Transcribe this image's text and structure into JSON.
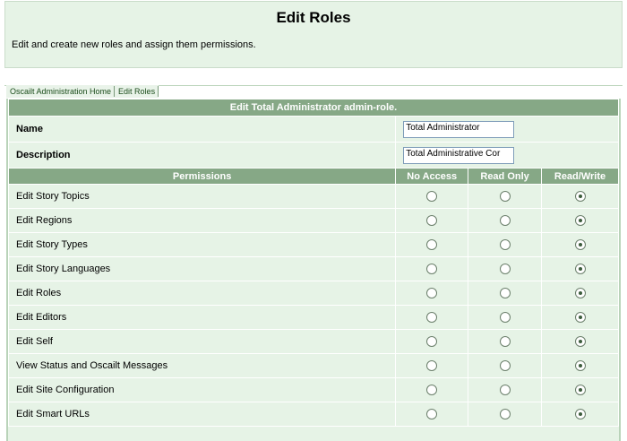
{
  "header": {
    "title": "Edit Roles",
    "description": "Edit and create new roles and assign them permissions."
  },
  "breadcrumb": [
    {
      "label": "Oscailt Administration Home"
    },
    {
      "label": "Edit Roles"
    }
  ],
  "form": {
    "title": "Edit Total Administrator admin-role.",
    "name_label": "Name",
    "name_value": "Total Administrator",
    "description_label": "Description",
    "description_value": "Total Administrative Cor"
  },
  "permissions_table": {
    "headers": [
      "Permissions",
      "No Access",
      "Read Only",
      "Read/Write"
    ],
    "rows": [
      {
        "label": "Edit Story Topics",
        "selected": "Read/Write"
      },
      {
        "label": "Edit Regions",
        "selected": "Read/Write"
      },
      {
        "label": "Edit Story Types",
        "selected": "Read/Write"
      },
      {
        "label": "Edit Story Languages",
        "selected": "Read/Write"
      },
      {
        "label": "Edit Roles",
        "selected": "Read/Write"
      },
      {
        "label": "Edit Editors",
        "selected": "Read/Write"
      },
      {
        "label": "Edit Self",
        "selected": "Read/Write"
      },
      {
        "label": "View Status and Oscailt Messages",
        "selected": "Read/Write"
      },
      {
        "label": "Edit Site Configuration",
        "selected": "Read/Write"
      },
      {
        "label": "Edit Smart URLs",
        "selected": "Read/Write"
      }
    ]
  },
  "colors": {
    "header_background": "#e6f3e6",
    "table_header": "#86a886",
    "row_background": "#e6f3e6"
  }
}
